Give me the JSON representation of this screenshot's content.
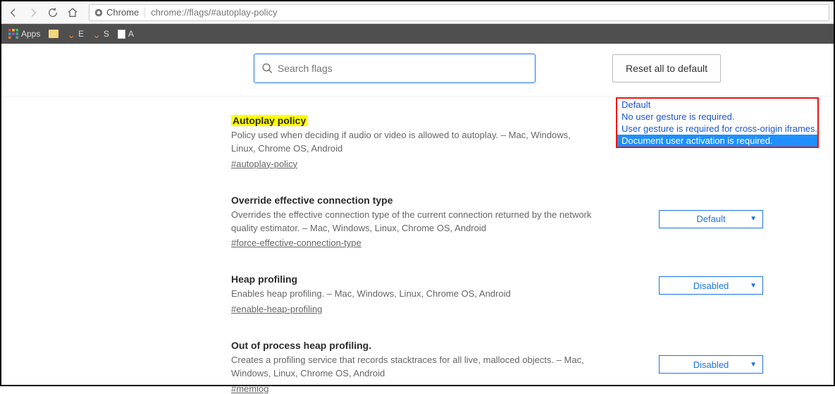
{
  "browser": {
    "url_prefix": "Chrome",
    "url_path": "chrome://flags/#autoplay-policy",
    "bookmarks": {
      "apps": "Apps",
      "e": "E",
      "s": "S",
      "a": "A"
    }
  },
  "search": {
    "placeholder": "Search flags"
  },
  "reset_label": "Reset all to default",
  "flags": [
    {
      "title": "Autoplay policy",
      "desc": "Policy used when deciding if audio or video is allowed to autoplay. – Mac, Windows, Linux, Chrome OS, Android",
      "anchor": "#autoplay-policy",
      "value": "Default",
      "highlighted": true
    },
    {
      "title": "Override effective connection type",
      "desc": "Overrides the effective connection type of the current connection returned by the network quality estimator. – Mac, Windows, Linux, Chrome OS, Android",
      "anchor": "#force-effective-connection-type",
      "value": "Default"
    },
    {
      "title": "Heap profiling",
      "desc": "Enables heap profiling. – Mac, Windows, Linux, Chrome OS, Android",
      "anchor": "#enable-heap-profiling",
      "value": "Disabled"
    },
    {
      "title": "Out of process heap profiling.",
      "desc": "Creates a profiling service that records stacktraces for all live, malloced objects. – Mac, Windows, Linux, Chrome OS, Android",
      "anchor": "#memlog",
      "value": "Disabled"
    }
  ],
  "dropdown": {
    "options": [
      "Default",
      "No user gesture is required.",
      "User gesture is required for cross-origin iframes.",
      "Document user activation is required."
    ],
    "selected_index": 3
  }
}
